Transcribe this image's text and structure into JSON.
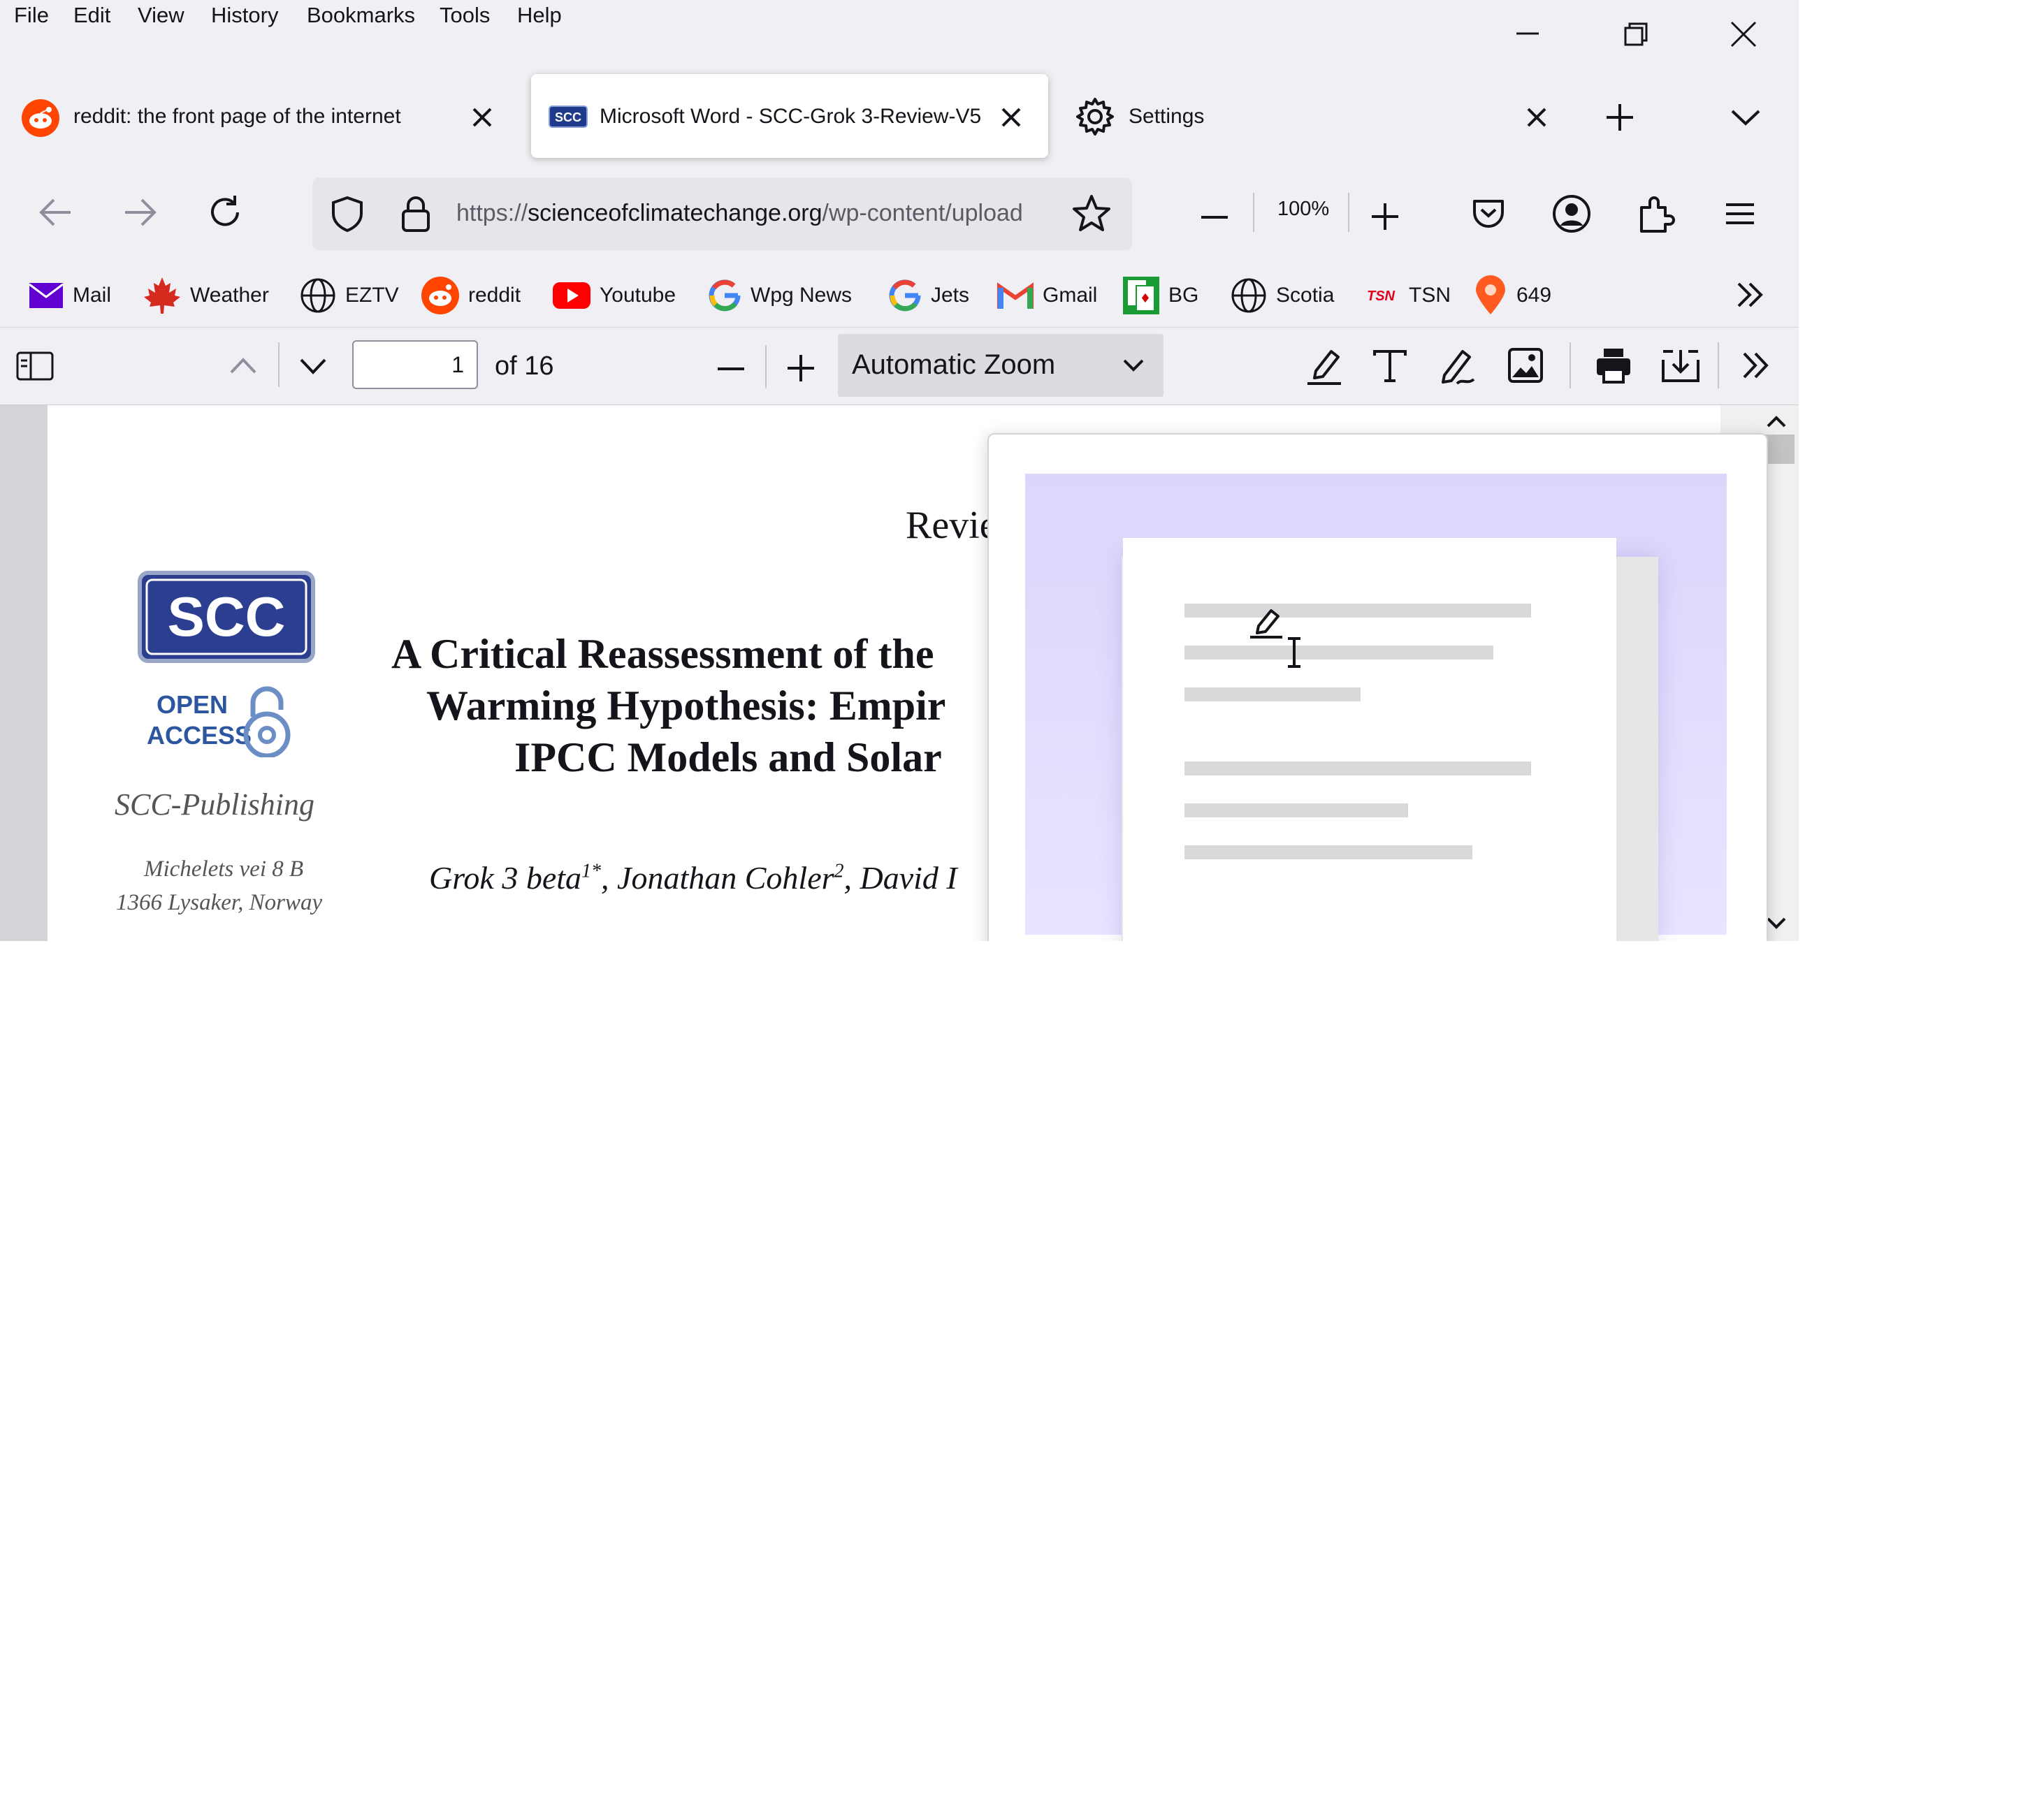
{
  "menu": [
    "File",
    "Edit",
    "View",
    "History",
    "Bookmarks",
    "Tools",
    "Help"
  ],
  "tabs": [
    {
      "title": "reddit: the front page of the internet",
      "icon": "reddit-icon",
      "active": false
    },
    {
      "title": "Microsoft Word - SCC-Grok 3-Review-V5",
      "icon": "scc-icon",
      "active": true
    },
    {
      "title": "Settings",
      "icon": "gear-icon",
      "active": false
    }
  ],
  "nav": {
    "url_scheme": "https://",
    "url_host": "scienceofclimatechange.org",
    "url_path": "/wp-content/upload",
    "zoom": "100%"
  },
  "bookmarks": [
    {
      "label": "Mail",
      "icon": "mail-icon"
    },
    {
      "label": "Weather",
      "icon": "maple-leaf-icon"
    },
    {
      "label": "EZTV",
      "icon": "globe-icon"
    },
    {
      "label": "reddit",
      "icon": "reddit-icon"
    },
    {
      "label": "Youtube",
      "icon": "youtube-icon"
    },
    {
      "label": "Wpg News",
      "icon": "google-icon"
    },
    {
      "label": "Jets",
      "icon": "google-icon"
    },
    {
      "label": "Gmail",
      "icon": "gmail-icon"
    },
    {
      "label": "BG",
      "icon": "cards-icon"
    },
    {
      "label": "Scotia",
      "icon": "globe-icon"
    },
    {
      "label": "TSN",
      "icon": "tsn-icon"
    },
    {
      "label": "649",
      "icon": "map-pin-icon"
    }
  ],
  "tsn_logo": "TSN",
  "pdf": {
    "page_number": "1",
    "page_of": "of 16",
    "zoom_mode": "Automatic Zoom"
  },
  "document": {
    "header": "Revie",
    "logo_text": "SCC",
    "open": "OPEN",
    "access": "ACCESS",
    "publisher": "SCC-Publishing",
    "address_1": "Michelets vei 8 B",
    "address_2": "1366 Lysaker, Norway",
    "title_1": "A Critical Reassessment of the",
    "title_2": "Warming Hypothesis: Empir",
    "title_3": "IPCC Models and Solar",
    "author_1": "Grok 3 beta",
    "author_1_sup": "1*",
    "author_2": ", Jonathan Cohler",
    "author_2_sup": "2",
    "author_3": ", David I"
  }
}
